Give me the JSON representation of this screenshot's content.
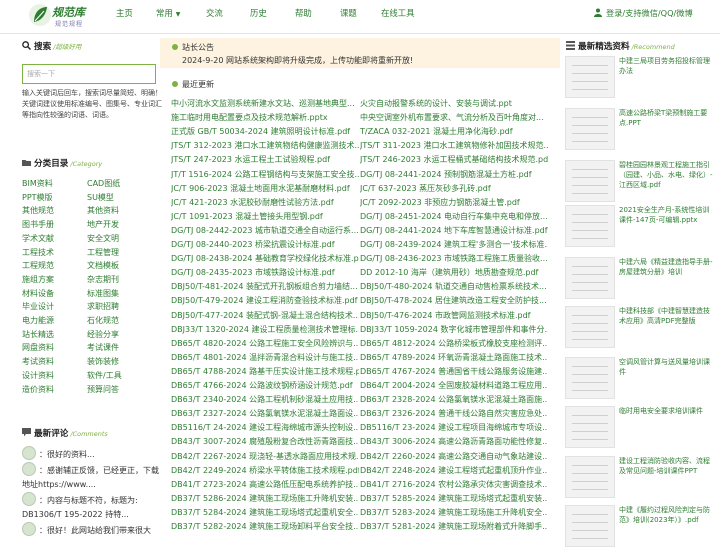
{
  "header": {
    "logo_name": "规范库",
    "logo_sub": "规范规程",
    "nav": [
      {
        "label": "主页"
      },
      {
        "label": "常用"
      },
      {
        "label": "交流"
      },
      {
        "label": "历史"
      },
      {
        "label": "帮助"
      },
      {
        "label": "课题"
      },
      {
        "label": "在线工具"
      }
    ],
    "login": "登录/支持微信/QQ/微博"
  },
  "search": {
    "title": "搜索",
    "title_en": "/超级好用",
    "placeholder": "搜索一下",
    "hint": "输入关键词后回车，搜索词尽量简短、明确！关键词建议使用标准编号、图集号、专业词汇等指向性较强的词语、词语。"
  },
  "categories": {
    "title": "分类目录",
    "title_en": "/Category",
    "items": [
      "BIM资料",
      "CAD图纸",
      "PPT模版",
      "SU模型",
      "其他规范",
      "其他资料",
      "图书手册",
      "地产开发",
      "学术文献",
      "安全文明",
      "工程技术",
      "工程管理",
      "工程规范",
      "文档模板",
      "施组方案",
      "杂志期刊",
      "材料设备",
      "标准图集",
      "毕业设计",
      "求职招聘",
      "电力能源",
      "石化规范",
      "站长精选",
      "经验分享",
      "网盘资料",
      "考试课件",
      "考试资料",
      "装饰装修",
      "设计资料",
      "软件/工具",
      "造价资料",
      "预算问答"
    ]
  },
  "comments": {
    "title": "最新评论",
    "title_en": "/Comments",
    "items": [
      "：很好的资料...",
      "：感谢辅正反馈，已经更正，下载地址https://www....",
      "：内容与标题不符，标题为: DB1306/T 195-2022 持特...",
      "：很好！此网站给我们带来很大"
    ]
  },
  "notice": {
    "title": "站长公告",
    "text": "2024-9-20 网站系统架构即将升级完成，上传功能即将重新开放!"
  },
  "recent": {
    "title": "最近更新",
    "rows": [
      [
        "中小河流水文监测系统新建水文站、巡测基地典型...",
        "火灾自动报警系统的设计、安装与调试.ppt"
      ],
      [
        "施工临时用电配置要点及技术规范解析.pptx",
        "中央空调室外机布置要求、气流分析及百叶角度对..."
      ],
      [
        "正式版 GB/T 50034-2024 建筑照明设计标准.pdf",
        "T/ZACA 032-2021 混凝土用净化海砂.pdf"
      ],
      [
        "JTS/T 312-2023 港口水工建筑物结构健康监测技术...",
        "JTS/T 311-2023 港口水工建筑物修补加固技术规范..."
      ],
      [
        "JTS/T 247-2023 水运工程土工试验规程.pdf",
        "JTS/T 246-2023 水运工程桶式基础结构技术规范.pdf"
      ],
      [
        "JT/T 1516-2024 公路工程钢结构与支架施工安全技...",
        "DG/TJ 08-2441-2024 预制钢筋混凝土方桩.pdf"
      ],
      [
        "JC/T 906-2023 混凝土地面用水泥基耐磨材料.pdf",
        "JC/T 637-2023 蒸压灰砂多孔砖.pdf"
      ],
      [
        "JC/T 421-2023 水泥胶砂耐磨性试验方法.pdf",
        "JC/T 2092-2023 非预应力钢筋混凝土管.pdf"
      ],
      [
        "JC/T 1091-2023 混凝土管接头用型钢.pdf",
        "DG/TJ 08-2451-2024 电动自行车集中充电和停放..."
      ],
      [
        "DG/TJ 08-2442-2023 城市轨道交通全自动运行系...",
        "DG/TJ 08-2441-2024 地下车库智慧通设计标准.pdf"
      ],
      [
        "DG/TJ 08-2440-2023 桥梁抗震设计标准.pdf",
        "DG/TJ 08-2439-2024 建筑工程'多测合一'技术标准..."
      ],
      [
        "DG/TJ 08-2438-2024 基础教育学校绿化技术标准.pdf",
        "DG/TJ 08-2436-2023 市域铁路工程施工质量验收..."
      ],
      [
        "DG/TJ 08-2435-2023 市域铁路设计标准.pdf",
        "DD 2012-10 海岸（建筑用砂）地质勘查规范.pdf"
      ],
      [
        "DBJ50/T-481-2024 装配式开孔钢板组合剪力墙结...",
        "DBJ50/T-480-2024 轨道交通自动售检票系统技术..."
      ],
      [
        "DBJ50/T-479-2024 建设工程消防查验技术标准.pdf",
        "DBJ50/T-478-2024 居住建筑改造工程安全防护技..."
      ],
      [
        "DBJ50/T-477-2024 装配式钢-混凝土混合结构技术...",
        "DBJ50/T-476-2024 市政管网监测技术标准.pdf"
      ],
      [
        "DBJ33/T 1320-2024 建设工程质量检测技术管理标...",
        "DBJ33/T 1059-2024 数字化城市管理部件和事件分..."
      ],
      [
        "DB65/T 4820-2024 公路工程施工安全风险辨识与...",
        "DB65/T 4812-2024 公路桥梁板式橡胶支座检测评..."
      ],
      [
        "DB65/T 4801-2024 温拌沥青混合料设计与施工技...",
        "DB65/T 4789-2024 环氧沥青混凝土路面施工技术..."
      ],
      [
        "DB65/T 4788-2024 路基干压实设计施工技术规程.pdf",
        "DB65/T 4767-2024 普通国省干线公路服务设施建..."
      ],
      [
        "DB65/T 4766-2024 公路波纹钢桥涵设计规范.pdf",
        "DB64/T 2004-2024 全固废胶凝材料道路工程应用..."
      ],
      [
        "DB63/T 2340-2024 公路工程机制砂混凝土应用技...",
        "DB63/T 2328-2024 公路氯氧镁水泥混凝土路面施..."
      ],
      [
        "DB63/T 2327-2024 公路氯氧镁水泥混凝土路面设...",
        "DB63/T 2326-2024 普通干线公路自然灾害应急处..."
      ],
      [
        "DB5116/T 24-2024 建设工程海绵城市源头控制设...",
        "DB5116/T 23-2024 建设工程项目海绵城市专项设..."
      ],
      [
        "DB43/T 3007-2024 腐殖殷粉复合改性沥青路面技...",
        "DB43/T 3006-2024 高速公路沥青路面功能性修复..."
      ],
      [
        "DB42/T 2267-2024 现浇轻-基透水路面应用技术规...",
        "DB42/T 2260-2024 高速公路交通自动气象站建设..."
      ],
      [
        "DB42/T 2249-2024 桥梁水平转体施工技术规程.pdf",
        "DB42/T 2248-2024 建设工程塔式起重机顶升作业..."
      ],
      [
        "DB41/T 2723-2024 高速公路低压配电系统养护技...",
        "DB41/T 2716-2024 农村公路承灾体灾害调查技术..."
      ],
      [
        "DB37/T 5286-2024 建筑施工现场施工升降机安装...",
        "DB37/T 5285-2024 建筑施工现场塔式起重机安装..."
      ],
      [
        "DB37/T 5284-2024 建筑施工现场塔式起重机安全...",
        "DB37/T 5283-2024 建筑施工现场施工升降机安全..."
      ],
      [
        "DB37/T 5282-2024 建筑施工现场卸料平台安全技...",
        "DB37/T 5281-2024 建筑施工现场附着式升降脚手..."
      ]
    ]
  },
  "featured": {
    "title": "最新精选资料",
    "title_en": "/Recommend",
    "items": [
      "中建三局项目劳务招投标管理办法",
      "高速公路桥梁T梁预制施工要点.PPT",
      "碧桂园园林景观工程施工指引（园建、小品、水电、绿化）-江西区域.pdf",
      "2021安全生产月-系统性培训课件-147页-可编辑.pptx",
      "中建六局《精益建造指导手册-房屋建筑分册》培训",
      "中建科技部《中建智慧建造技术应用》高清PDF完整版",
      "空调风管计算与送风量培训课件",
      "临时用电安全要求培训课件",
      "建设工程消防验收内容、流程及常见问题-培训课件PPT",
      "中建《履约过程风险判定与防范》培训(2023年）》.pdf"
    ]
  }
}
